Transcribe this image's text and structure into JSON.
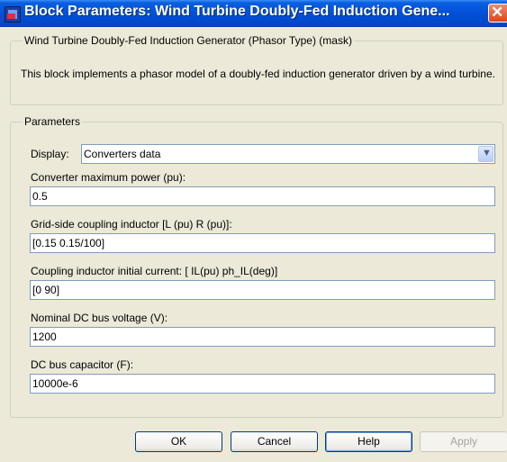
{
  "window": {
    "title": "Block Parameters: Wind Turbine Doubly-Fed Induction Gene..."
  },
  "mask": {
    "group_title": "Wind Turbine Doubly-Fed Induction Generator (Phasor Type) (mask)",
    "description": "This block implements a phasor model of a doubly-fed induction generator driven by a wind turbine."
  },
  "parameters": {
    "group_title": "Parameters",
    "display_label": "Display:",
    "display_value": "Converters data",
    "fields": [
      {
        "label": "Converter maximum power (pu):",
        "value": "0.5"
      },
      {
        "label": "Grid-side coupling inductor [L (pu) R (pu)]:",
        "value": "[0.15 0.15/100]"
      },
      {
        "label": "Coupling inductor initial current: [ IL(pu) ph_IL(deg)]",
        "value": "[0 90]"
      },
      {
        "label": "Nominal DC bus voltage (V):",
        "value": "1200"
      },
      {
        "label": "DC bus capacitor (F):",
        "value": "10000e-6"
      }
    ]
  },
  "buttons": {
    "ok": "OK",
    "cancel": "Cancel",
    "help": "Help",
    "apply": "Apply"
  }
}
